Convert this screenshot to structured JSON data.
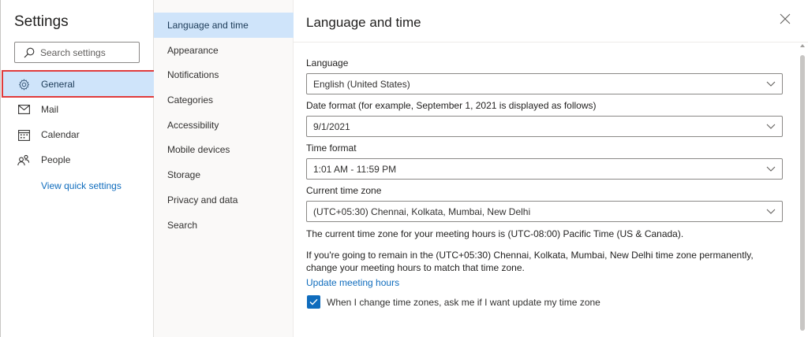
{
  "sidebar": {
    "title": "Settings",
    "search_placeholder": "Search settings",
    "items": [
      {
        "label": "General",
        "icon": "gear-icon",
        "active": true
      },
      {
        "label": "Mail",
        "icon": "mail-icon"
      },
      {
        "label": "Calendar",
        "icon": "calendar-icon"
      },
      {
        "label": "People",
        "icon": "people-icon"
      }
    ],
    "quick_settings_link": "View quick settings"
  },
  "subnav": {
    "items": [
      {
        "label": "Language and time",
        "active": true
      },
      {
        "label": "Appearance"
      },
      {
        "label": "Notifications"
      },
      {
        "label": "Categories"
      },
      {
        "label": "Accessibility"
      },
      {
        "label": "Mobile devices"
      },
      {
        "label": "Storage"
      },
      {
        "label": "Privacy and data"
      },
      {
        "label": "Search"
      }
    ]
  },
  "main": {
    "title": "Language and time",
    "language": {
      "label": "Language",
      "value": "English (United States)"
    },
    "date_format": {
      "label": "Date format (for example, September 1, 2021 is displayed as follows)",
      "value": "9/1/2021"
    },
    "time_format": {
      "label": "Time format",
      "value": "1:01 AM - 11:59 PM"
    },
    "time_zone": {
      "label": "Current time zone",
      "value": "(UTC+05:30) Chennai, Kolkata, Mumbai, New Delhi"
    },
    "meeting_hours_note": "The current time zone for your meeting hours is (UTC-08:00) Pacific Time (US & Canada).",
    "remain_note_line1": "If you're going to remain in the (UTC+05:30) Chennai, Kolkata, Mumbai, New Delhi time zone permanently,",
    "remain_note_line2": "change your meeting hours to match that time zone.",
    "update_link": "Update meeting hours",
    "checkbox_label": "When I change time zones, ask me if I want update my time zone",
    "checkbox_checked": true
  },
  "colors": {
    "accent": "#0f6cbd",
    "selected_bg": "#cfe4fa",
    "highlight_border": "#e03b3b"
  }
}
